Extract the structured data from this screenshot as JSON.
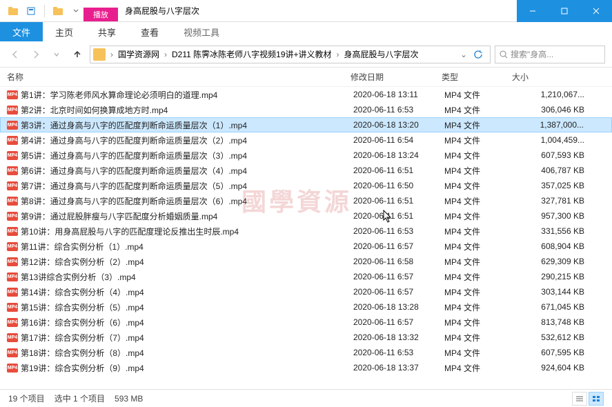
{
  "window": {
    "contextual_label": "播放",
    "contextual_title": "视频工具",
    "title": "身高屁股与八字层次"
  },
  "ribbon": {
    "file": "文件",
    "home": "主页",
    "share": "共享",
    "view": "查看",
    "video": "视频工具"
  },
  "breadcrumb": {
    "seg1": "国学资源网",
    "seg2": "D211 陈霁冰陈老师八字视频19讲+讲义教材",
    "seg3": "身高屁股与八字层次"
  },
  "search": {
    "placeholder": "搜索\"身高..."
  },
  "columns": {
    "name": "名称",
    "date": "修改日期",
    "type": "类型",
    "size": "大小"
  },
  "files": [
    {
      "name": "第1讲：学习陈老师风水算命理论必须明白的道理.mp4",
      "date": "2020-06-18 13:11",
      "type": "MP4 文件",
      "size": "1,210,067..."
    },
    {
      "name": "第2讲：北京时间如何换算成地方时.mp4",
      "date": "2020-06-11 6:53",
      "type": "MP4 文件",
      "size": "306,046 KB"
    },
    {
      "name": "第3讲：通过身高与八字的匹配度判断命运质量层次（1）.mp4",
      "date": "2020-06-18 13:20",
      "type": "MP4 文件",
      "size": "1,387,000...",
      "selected": true
    },
    {
      "name": "第4讲：通过身高与八字的匹配度判断命运质量层次（2）.mp4",
      "date": "2020-06-11 6:54",
      "type": "MP4 文件",
      "size": "1,004,459..."
    },
    {
      "name": "第5讲：通过身高与八字的匹配度判断命运质量层次（3）.mp4",
      "date": "2020-06-18 13:24",
      "type": "MP4 文件",
      "size": "607,593 KB"
    },
    {
      "name": "第6讲：通过身高与八字的匹配度判断命运质量层次（4）.mp4",
      "date": "2020-06-11 6:51",
      "type": "MP4 文件",
      "size": "406,787 KB"
    },
    {
      "name": "第7讲：通过身高与八字的匹配度判断命运质量层次（5）.mp4",
      "date": "2020-06-11 6:50",
      "type": "MP4 文件",
      "size": "357,025 KB"
    },
    {
      "name": "第8讲：通过身高与八字的匹配度判断命运质量层次（6）.mp4",
      "date": "2020-06-11 6:51",
      "type": "MP4 文件",
      "size": "327,781 KB"
    },
    {
      "name": "第9讲：通过屁股胖瘦与八字匹配度分析婚姻质量.mp4",
      "date": "2020-06-11 6:51",
      "type": "MP4 文件",
      "size": "957,300 KB"
    },
    {
      "name": "第10讲：用身高屁股与八字的匹配度理论反推出生时辰.mp4",
      "date": "2020-06-11 6:53",
      "type": "MP4 文件",
      "size": "331,556 KB"
    },
    {
      "name": "第11讲：综合实例分析（1）.mp4",
      "date": "2020-06-11 6:57",
      "type": "MP4 文件",
      "size": "608,904 KB"
    },
    {
      "name": "第12讲：综合实例分析（2）.mp4",
      "date": "2020-06-11 6:58",
      "type": "MP4 文件",
      "size": "629,309 KB"
    },
    {
      "name": "第13讲综合实例分析（3）.mp4",
      "date": "2020-06-11 6:57",
      "type": "MP4 文件",
      "size": "290,215 KB"
    },
    {
      "name": "第14讲：综合实例分析（4）.mp4",
      "date": "2020-06-11 6:57",
      "type": "MP4 文件",
      "size": "303,144 KB"
    },
    {
      "name": "第15讲：综合实例分析（5）.mp4",
      "date": "2020-06-18 13:28",
      "type": "MP4 文件",
      "size": "671,045 KB"
    },
    {
      "name": "第16讲：综合实例分析（6）.mp4",
      "date": "2020-06-11 6:57",
      "type": "MP4 文件",
      "size": "813,748 KB"
    },
    {
      "name": "第17讲：综合实例分析（7）.mp4",
      "date": "2020-06-18 13:32",
      "type": "MP4 文件",
      "size": "532,612 KB"
    },
    {
      "name": "第18讲：综合实例分析（8）.mp4",
      "date": "2020-06-11 6:53",
      "type": "MP4 文件",
      "size": "607,595 KB"
    },
    {
      "name": "第19讲：综合实例分析（9）.mp4",
      "date": "2020-06-18 13:37",
      "type": "MP4 文件",
      "size": "924,604 KB"
    }
  ],
  "status": {
    "count": "19 个项目",
    "selection": "选中 1 个项目",
    "size": "593 MB"
  },
  "watermark": "國學資源"
}
